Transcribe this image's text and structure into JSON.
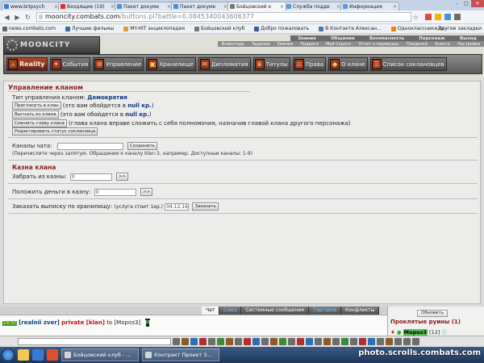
{
  "browser": {
    "tabs": [
      {
        "title": "www.brtpsych",
        "color": "#3a7bd5",
        "active": false
      },
      {
        "title": "Входящие (19)",
        "color": "#d93025",
        "active": false
      },
      {
        "title": "Пакет докуме",
        "color": "#4a90d9",
        "active": false
      },
      {
        "title": "Пакет докуме",
        "color": "#4a90d9",
        "active": false
      },
      {
        "title": "Бойцовский к",
        "color": "#777777",
        "active": true
      },
      {
        "title": "Служба подде",
        "color": "#5b9bd5",
        "active": false
      },
      {
        "title": "Информация",
        "color": "#5b9bd5",
        "active": false
      }
    ],
    "url_domain": "mooncity.combats.com",
    "url_rest": "/buttons.pl?battle=0.0845340043606377",
    "bookmarks": [
      {
        "label": "news.combats.com",
        "color": "#666666"
      },
      {
        "label": "Лучшие фильмы",
        "color": "#3a6aa5"
      },
      {
        "label": "MY-HIT энциклопедия",
        "color": "#e0a030"
      },
      {
        "label": "Бойцовский клуб",
        "color": "#777777"
      },
      {
        "label": "Добро пожаловать",
        "color": "#3b5998"
      },
      {
        "label": "В Контакте Алексан...",
        "color": "#4a76a8"
      },
      {
        "label": "Одноклассники.ru -",
        "color": "#ee8208"
      }
    ],
    "other_bookmarks": "Другие закладки"
  },
  "header": {
    "logo": "MOONCITY",
    "topmenu": [
      "Знания",
      "Общение",
      "Безопасность",
      "Персонаж",
      "Выход"
    ],
    "submenu": [
      "Инвентарь",
      "Задания",
      "Умения",
      "Подвиги",
      "Мой Скролл",
      "Отчет о переводах",
      "Поединки",
      "Анкета",
      "Настройки"
    ],
    "nav": [
      {
        "label": "Reality",
        "active": true
      },
      {
        "label": "События",
        "active": false
      },
      {
        "label": "Управление",
        "active": false
      },
      {
        "label": "Хранилище",
        "active": false
      },
      {
        "label": "Дипломатия",
        "active": false
      },
      {
        "label": "Титулы",
        "active": false
      },
      {
        "label": "Права",
        "active": false
      },
      {
        "label": "О клане",
        "active": false
      },
      {
        "label": "Список соклановцев",
        "active": false
      }
    ]
  },
  "main": {
    "title": "Управление кланом",
    "type_label": "Тип управления кланом:",
    "type_value": "Демократия",
    "invite_button": "Пригласить в клан",
    "invite_cost_prefix": "(это вам обойдется в",
    "invite_cost": "null кр.",
    "invite_cost_suffix": ")",
    "kick_button": "Выгнать из клана",
    "kick_cost_prefix": "(это вам обойдется в",
    "kick_cost": "null кр.",
    "kick_cost_suffix": ")",
    "change_head_button": "Сменить главу клана",
    "change_head_note": "(глава клана вправе сложить с себя полномочия, назначив главой клана другого персонажа)",
    "status_button": "Редактировать статус соклановца",
    "channels_label": "Каналы чата:",
    "channels_value": "",
    "save_button": "Сохранить",
    "channels_hint": "(Перечислите через запятую. Обращение к каналу klan-3, например. Доступные каналы: 1-9)",
    "treasury_title": "Казна клана",
    "withdraw_label": "Забрать из казны:",
    "withdraw_value": "0",
    "withdraw_go": ">>",
    "deposit_label": "Положить деньги в казну:",
    "deposit_value": "0",
    "deposit_go": ">>",
    "report_label": "Заказать выписку по хранилищу:",
    "report_cost": "(услуга стоит 1кр.)",
    "report_date": "04.12.16",
    "order_button": "Заказать"
  },
  "chat": {
    "tabs": [
      "Чат",
      "Союз",
      "Системные сообщения",
      "Торговля",
      "Конфликты"
    ],
    "message": {
      "time": "19:32",
      "from": "[realnii zver]",
      "private": "private [klan]",
      "to_word": "to",
      "to": "[Мороз3]"
    },
    "refresh_button": "Обновить",
    "location": "Проклятые руины (1)",
    "online_nick": "Мороз3",
    "online_level": "[12]"
  },
  "taskbar": {
    "windows": [
      "Бойцовский клуб - ...",
      "Контракт Проект 3..."
    ]
  },
  "watermark": "photo.scrolls.combats.com"
}
